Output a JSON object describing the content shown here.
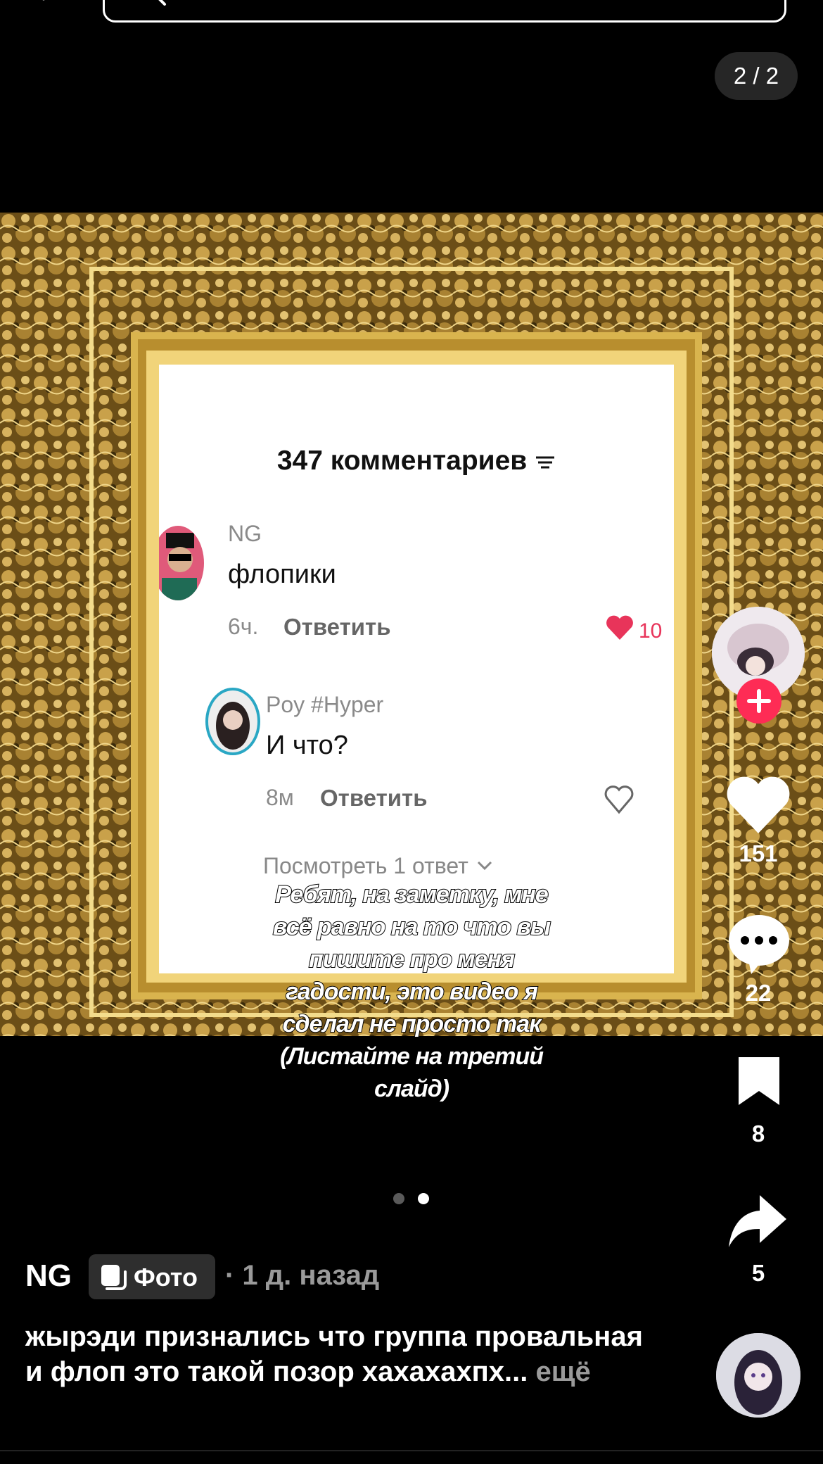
{
  "top_bar": {
    "slide_counter": "2 / 2"
  },
  "post_image": {
    "comments_header": "347 комментариев",
    "comments": [
      {
        "username": "NG",
        "text": "флопики",
        "time": "6ч.",
        "reply_label": "Ответить",
        "likes": "10",
        "liked": true
      },
      {
        "username": "Poy #Hyper",
        "text": "И что?",
        "time": "8м",
        "reply_label": "Ответить",
        "liked": false
      }
    ],
    "view_replies": "Посмотреть 1 ответ",
    "overlay_caption_lines": [
      "Ребят, на заметку, мне",
      "всё равно на то что вы",
      "пишите про меня",
      "гадости, это видео я",
      "сделал не просто так",
      "(Листайте на третий",
      "слайд)"
    ]
  },
  "actions": {
    "likes": "151",
    "comments": "22",
    "saves": "8",
    "shares": "5"
  },
  "pagination": {
    "total": 2,
    "active": 2
  },
  "post_info": {
    "author": "NG",
    "badge_label": "Фото",
    "time": "· 1 д. назад",
    "caption_text": "жырэди признались что группа провальная и флоп это такой позор хахахахпх...",
    "caption_more": " ещё"
  },
  "colors": {
    "accent": "#fe2c55",
    "badge_bg": "#2e2e2e",
    "muted_text": "#9a9a9a",
    "frame_gold": "#c9a14a"
  },
  "icons": [
    "back-arrow-icon",
    "search-icon",
    "filter-icon",
    "heart-icon",
    "comment-icon",
    "bookmark-icon",
    "share-icon",
    "photo-icon",
    "plus-icon"
  ]
}
